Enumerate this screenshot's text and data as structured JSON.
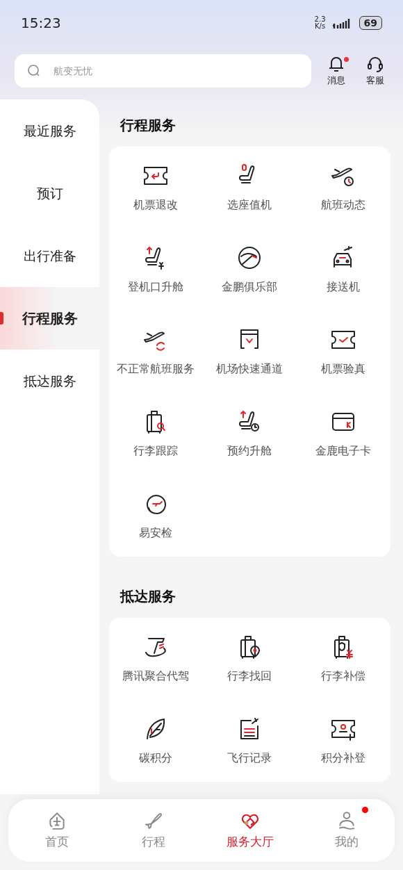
{
  "status_bar": {
    "time": "15:23",
    "net_speed": "2.3",
    "net_unit": "K/s",
    "battery": "69"
  },
  "search": {
    "placeholder": "航变无忧"
  },
  "header_actions": [
    {
      "label": "消息",
      "badge": true
    },
    {
      "label": "客服",
      "badge": false
    }
  ],
  "sidebar": {
    "items": [
      {
        "label": "最近服务",
        "selected": false
      },
      {
        "label": "预订",
        "selected": false
      },
      {
        "label": "出行准备",
        "selected": false
      },
      {
        "label": "行程服务",
        "selected": true
      },
      {
        "label": "抵达服务",
        "selected": false
      }
    ]
  },
  "sections": [
    {
      "title": "行程服务",
      "items": [
        {
          "label": "机票退改"
        },
        {
          "label": "选座值机"
        },
        {
          "label": "航班动态"
        },
        {
          "label": "登机口升舱"
        },
        {
          "label": "金鹏俱乐部"
        },
        {
          "label": "接送机"
        },
        {
          "label": "不正常航班服务"
        },
        {
          "label": "机场快速通道"
        },
        {
          "label": "机票验真"
        },
        {
          "label": "行李跟踪"
        },
        {
          "label": "预约升舱"
        },
        {
          "label": "金鹿电子卡"
        },
        {
          "label": "易安检"
        }
      ]
    },
    {
      "title": "抵达服务",
      "items": [
        {
          "label": "腾讯聚合代驾"
        },
        {
          "label": "行李找回"
        },
        {
          "label": "行李补偿"
        },
        {
          "label": "碳积分"
        },
        {
          "label": "飞行记录"
        },
        {
          "label": "积分补登"
        }
      ]
    }
  ],
  "tab_bar": [
    {
      "label": "首页",
      "selected": false,
      "badge": false
    },
    {
      "label": "行程",
      "selected": false,
      "badge": false
    },
    {
      "label": "服务大厅",
      "selected": true,
      "badge": false
    },
    {
      "label": "我的",
      "selected": false,
      "badge": true
    }
  ]
}
